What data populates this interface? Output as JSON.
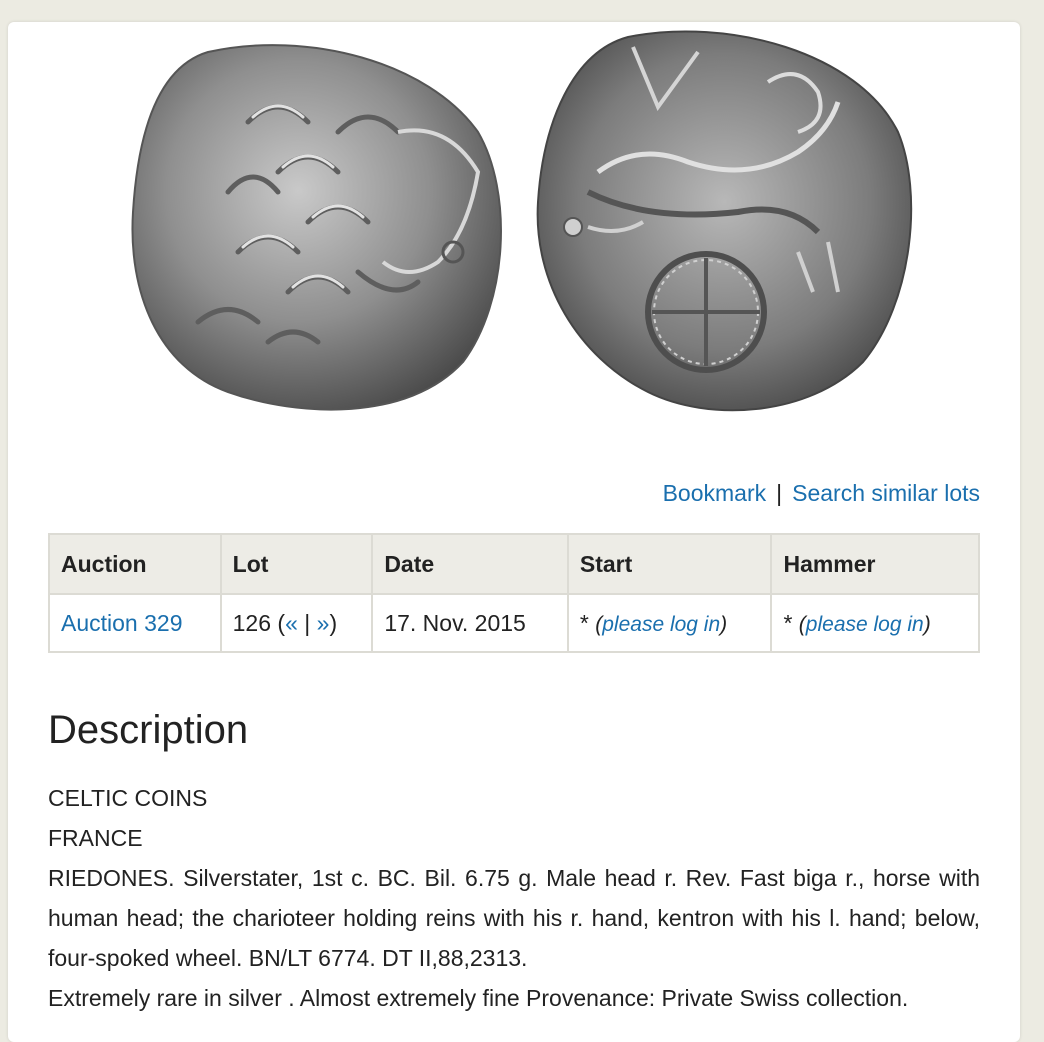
{
  "actions": {
    "bookmark": "Bookmark",
    "separator": "|",
    "search_similar": "Search similar lots"
  },
  "table": {
    "headers": {
      "auction": "Auction",
      "lot": "Lot",
      "date": "Date",
      "start": "Start",
      "hammer": "Hammer"
    },
    "row": {
      "auction": "Auction 329",
      "lot_number": "126",
      "lot_open": "(",
      "prev": "«",
      "lot_sep": "|",
      "next": "»",
      "lot_close": ")",
      "date": "17. Nov. 2015",
      "star": "*",
      "login_open": "(",
      "please_log_in": "please log in",
      "login_close": ")"
    }
  },
  "description": {
    "title": "Description",
    "category": "CELTIC COINS",
    "region": "FRANCE",
    "text": "RIEDONES. Silverstater, 1st c. BC. Bil. 6.75 g. Male head r. Rev. Fast biga r., horse with human head; the charioteer holding reins with his r. hand, kentron with his l. hand; below, four-spoked wheel. BN/LT 6774. DT II,88,2313.",
    "notes": "Extremely rare in silver . Almost extremely fine Provenance: Private Swiss collection."
  }
}
